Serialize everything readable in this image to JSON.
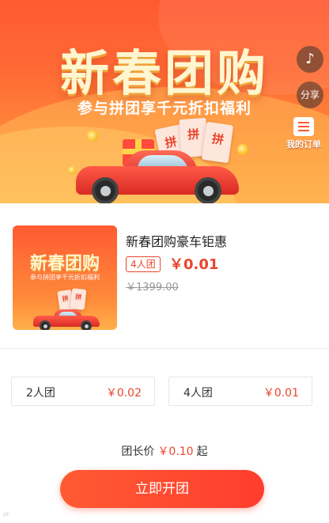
{
  "banner": {
    "title": "新春团购",
    "subtitle": "参与拼团享千元折扣福利",
    "coupon_text": "拼",
    "music_icon": "music-note-icon",
    "share_label": "分享",
    "orders_label": "我的订单",
    "colors": {
      "start": "#ff5a32",
      "end": "#ffa646"
    }
  },
  "product": {
    "name": "新春团购豪车钜惠",
    "thumb_title": "新春团购",
    "thumb_subtitle": "参与拼团享千元折扣福利",
    "group_tag": "4人团",
    "price": "￥0.01",
    "original_price": "￥1399.00"
  },
  "options": [
    {
      "label": "2人团",
      "price": "￥0.02"
    },
    {
      "label": "4人团",
      "price": "￥0.01"
    }
  ],
  "leader": {
    "prefix": "团长价",
    "price": "￥0.10",
    "suffix": "起"
  },
  "cta_label": "立即开团",
  "accent_color": "#e8452c"
}
